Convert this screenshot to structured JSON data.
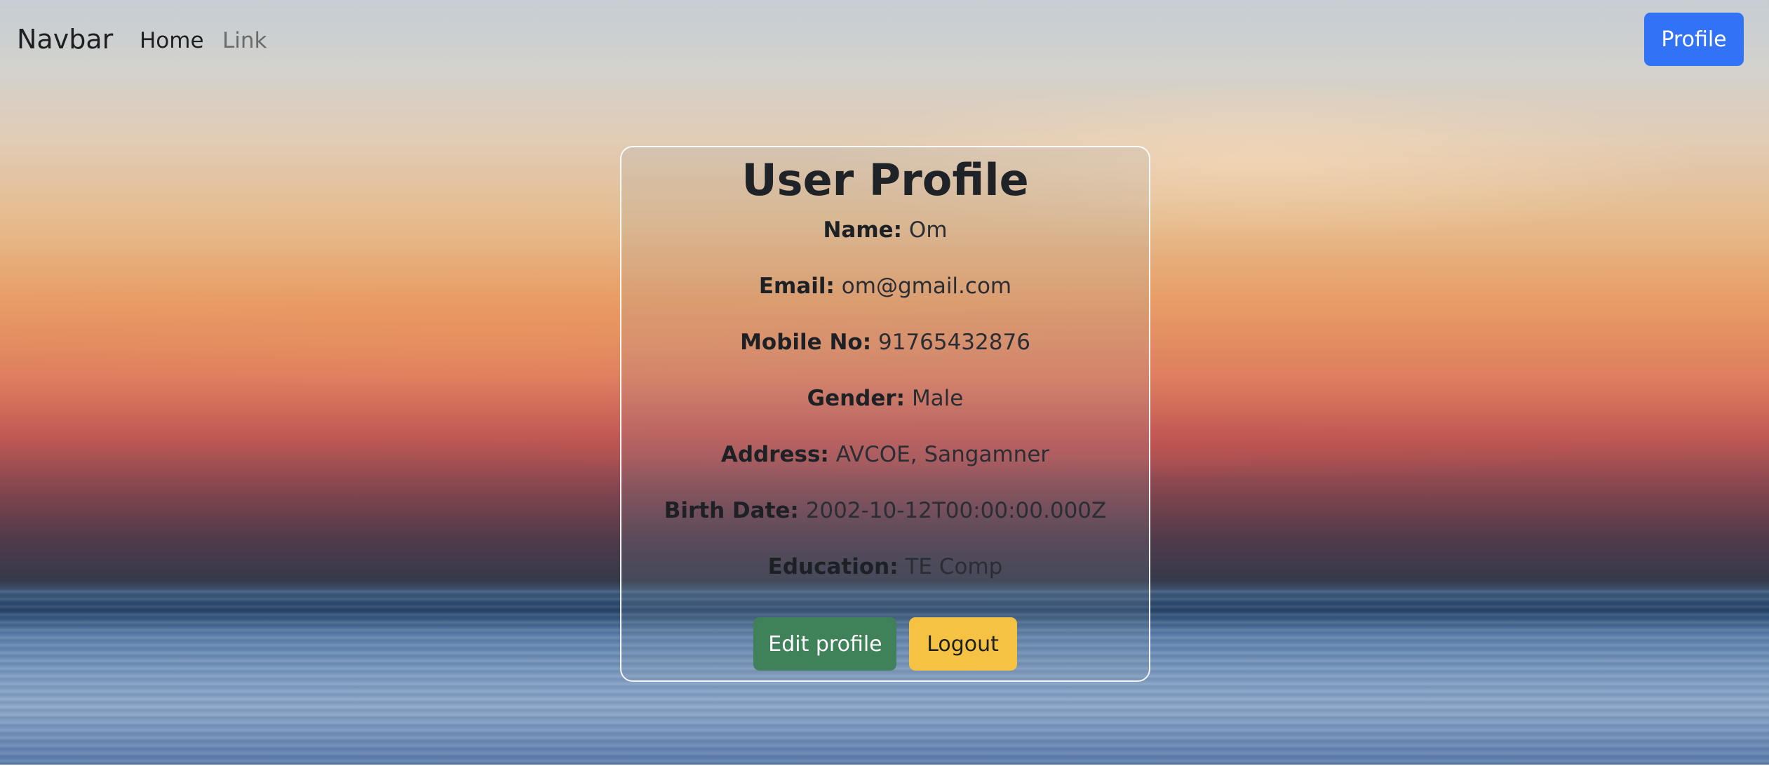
{
  "navbar": {
    "brand": "Navbar",
    "links": [
      {
        "label": "Home"
      },
      {
        "label": "Link"
      }
    ],
    "profile_button": "Profile"
  },
  "card": {
    "title": "User Profile",
    "fields": [
      {
        "label": "Name:",
        "value": "Om"
      },
      {
        "label": "Email:",
        "value": "om@gmail.com"
      },
      {
        "label": "Mobile No:",
        "value": "91765432876"
      },
      {
        "label": "Gender:",
        "value": "Male"
      },
      {
        "label": "Address:",
        "value": "AVCOE, Sangamner"
      },
      {
        "label": "Birth Date:",
        "value": "2002-10-12T00:00:00.000Z"
      },
      {
        "label": "Education:",
        "value": "TE Comp"
      }
    ],
    "edit_button": "Edit profile",
    "logout_button": "Logout"
  },
  "colors": {
    "primary": "#3273f6",
    "success": "#3f8259",
    "warning": "#f6c243"
  }
}
